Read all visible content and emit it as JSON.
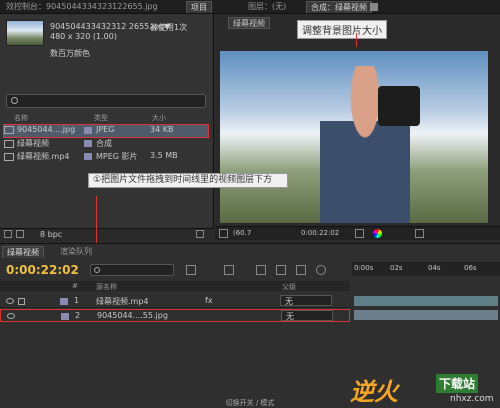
{
  "tabs": {
    "left": "效控制台：9045044334323122655.jpg",
    "project": "项目",
    "menu_icon": "panel-menu-icon",
    "layer": "图层：(无)",
    "comp": "合成：绿幕视频"
  },
  "project": {
    "file_name": "904504433432312 2655.jpg▼",
    "used": "被使用1次",
    "size": "480 x 320 (1.00)",
    "color": "数百万颜色",
    "search_placeholder": "",
    "columns": {
      "name": "名称",
      "type": "类型",
      "size": "大小"
    },
    "items": [
      {
        "name": "9045044....jpg",
        "type": "JPEG",
        "size": "34 KB",
        "icon": "image-icon",
        "color": "#8a8ab0"
      },
      {
        "name": "绿幕视频",
        "type": "合成",
        "size": "",
        "icon": "composition-icon",
        "color": "#8a8ab0"
      },
      {
        "name": "绿幕视频.mp4",
        "type": "MPEG 影片",
        "size": "3.5 MB",
        "icon": "video-icon",
        "color": "#8a8ab0"
      }
    ],
    "bpc": "8 bpc"
  },
  "viewer": {
    "comp_tab": "绿幕视频",
    "zoom": "(60.7",
    "timecode": "0:00:22:02",
    "annotation_top": "调整背景图片大小",
    "annotation_mid": "①把图片文件拖拽到时间线里的视频图层下方"
  },
  "timeline": {
    "tab_comp": "绿幕视频",
    "tab_render": "渲染队列",
    "timecode": "0:00:22:02",
    "ruler": [
      "0:00s",
      "02s",
      "04s",
      "06s"
    ],
    "headers": {
      "num": "#",
      "name": "源名称",
      "parent": "父级"
    },
    "layers": [
      {
        "num": "1",
        "name": "绿幕视频.mp4",
        "parent": "无"
      },
      {
        "num": "2",
        "name": "9045044....55.jpg",
        "parent": "无"
      }
    ],
    "footer": "切换开关 / 模式"
  },
  "watermark": {
    "text": "逆火",
    "sub": "下载站",
    "url": "nhxz.com"
  }
}
